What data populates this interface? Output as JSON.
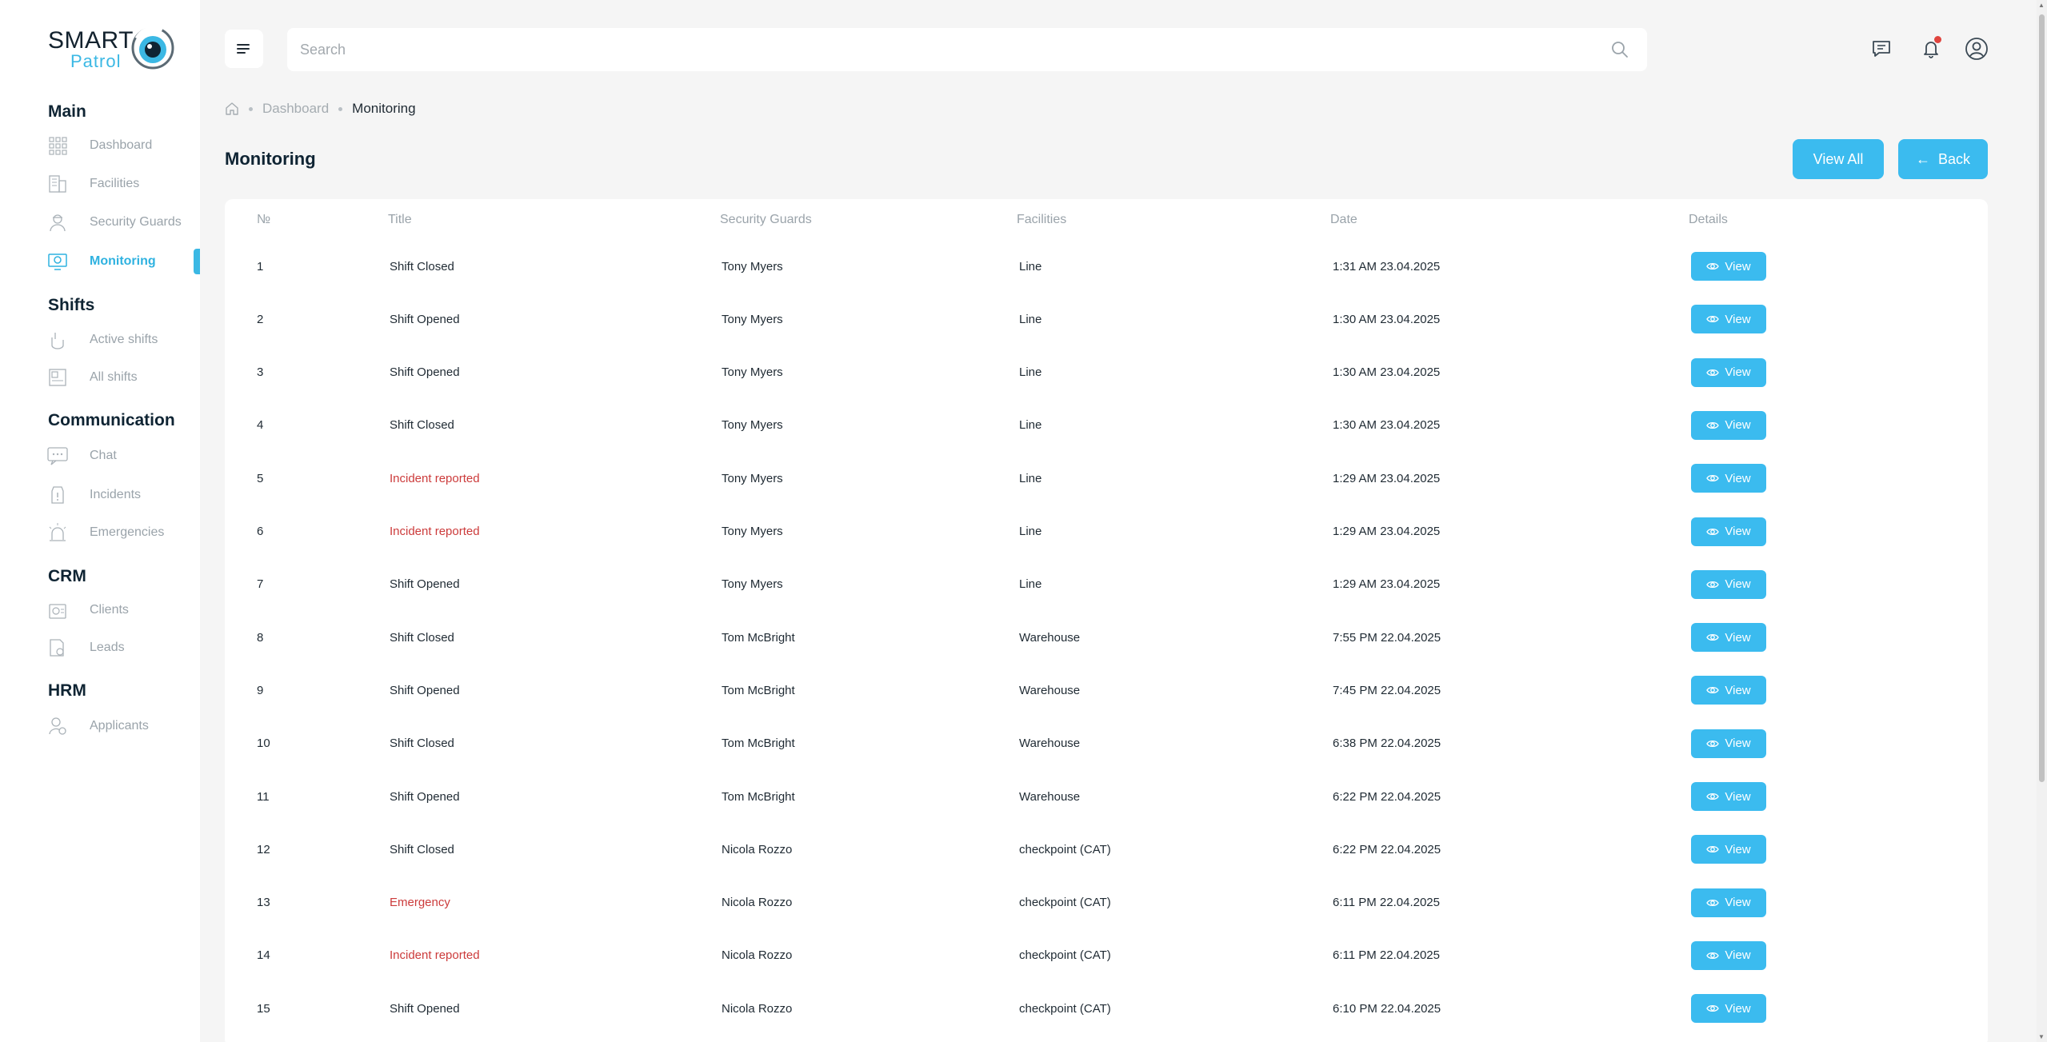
{
  "brand": {
    "name_top": "SMART",
    "name_bottom": "Patrol",
    "accent": "#3bb8e4"
  },
  "sidebar": {
    "sections": [
      {
        "title": "Main",
        "items": [
          {
            "label": "Dashboard",
            "icon": "dashboard-grid-icon"
          },
          {
            "label": "Facilities",
            "icon": "building-icon"
          },
          {
            "label": "Security Guards",
            "icon": "guard-icon"
          },
          {
            "label": "Monitoring",
            "icon": "monitor-icon",
            "active": true
          }
        ]
      },
      {
        "title": "Shifts",
        "items": [
          {
            "label": "Active shifts",
            "icon": "active-shifts-icon"
          },
          {
            "label": "All shifts",
            "icon": "all-shifts-icon"
          }
        ]
      },
      {
        "title": "Communication",
        "items": [
          {
            "label": "Chat",
            "icon": "chat-icon"
          },
          {
            "label": "Incidents",
            "icon": "incident-icon"
          },
          {
            "label": "Emergencies",
            "icon": "siren-icon"
          }
        ]
      },
      {
        "title": "CRM",
        "items": [
          {
            "label": "Clients",
            "icon": "clients-icon"
          },
          {
            "label": "Leads",
            "icon": "leads-icon"
          }
        ]
      },
      {
        "title": "HRM",
        "items": [
          {
            "label": "Applicants",
            "icon": "applicants-icon"
          }
        ]
      }
    ]
  },
  "topbar": {
    "search_placeholder": "Search",
    "icons": [
      "menu-icon",
      "search-icon",
      "messages-icon",
      "notification-bell-icon",
      "user-profile-icon"
    ]
  },
  "breadcrumb": {
    "home_icon": "home-icon",
    "items": [
      "Dashboard",
      "Monitoring"
    ]
  },
  "page": {
    "title": "Monitoring",
    "view_all_label": "View All",
    "back_label": "Back"
  },
  "table": {
    "headers": [
      "№",
      "Title",
      "Security Guards",
      "Facilities",
      "Date",
      "Details"
    ],
    "view_label": "View",
    "rows": [
      {
        "no": "1",
        "title": "Shift Closed",
        "guard": "Tony Myers",
        "facility": "Line",
        "date": "1:31 AM 23.04.2025",
        "alert": false
      },
      {
        "no": "2",
        "title": "Shift Opened",
        "guard": "Tony Myers",
        "facility": "Line",
        "date": "1:30 AM 23.04.2025",
        "alert": false
      },
      {
        "no": "3",
        "title": "Shift Opened",
        "guard": "Tony Myers",
        "facility": "Line",
        "date": "1:30 AM 23.04.2025",
        "alert": false
      },
      {
        "no": "4",
        "title": "Shift Closed",
        "guard": "Tony Myers",
        "facility": "Line",
        "date": "1:30 AM 23.04.2025",
        "alert": false
      },
      {
        "no": "5",
        "title": "Incident reported",
        "guard": "Tony Myers",
        "facility": "Line",
        "date": "1:29 AM 23.04.2025",
        "alert": true
      },
      {
        "no": "6",
        "title": "Incident reported",
        "guard": "Tony Myers",
        "facility": "Line",
        "date": "1:29 AM 23.04.2025",
        "alert": true
      },
      {
        "no": "7",
        "title": "Shift Opened",
        "guard": "Tony Myers",
        "facility": "Line",
        "date": "1:29 AM 23.04.2025",
        "alert": false
      },
      {
        "no": "8",
        "title": "Shift Closed",
        "guard": "Tom McBright",
        "facility": "Warehouse",
        "date": "7:55 PM 22.04.2025",
        "alert": false
      },
      {
        "no": "9",
        "title": "Shift Opened",
        "guard": "Tom McBright",
        "facility": "Warehouse",
        "date": "7:45 PM 22.04.2025",
        "alert": false
      },
      {
        "no": "10",
        "title": "Shift Closed",
        "guard": "Tom McBright",
        "facility": "Warehouse",
        "date": "6:38 PM 22.04.2025",
        "alert": false
      },
      {
        "no": "11",
        "title": "Shift Opened",
        "guard": "Tom McBright",
        "facility": "Warehouse",
        "date": "6:22 PM 22.04.2025",
        "alert": false
      },
      {
        "no": "12",
        "title": "Shift Closed",
        "guard": "Nicola Rozzo",
        "facility": "checkpoint (CAT)",
        "date": "6:22 PM 22.04.2025",
        "alert": false
      },
      {
        "no": "13",
        "title": "Emergency",
        "guard": "Nicola Rozzo",
        "facility": "checkpoint (CAT)",
        "date": "6:11 PM 22.04.2025",
        "alert": true
      },
      {
        "no": "14",
        "title": "Incident reported",
        "guard": "Nicola Rozzo",
        "facility": "checkpoint (CAT)",
        "date": "6:11 PM 22.04.2025",
        "alert": true
      },
      {
        "no": "15",
        "title": "Shift Opened",
        "guard": "Nicola Rozzo",
        "facility": "checkpoint (CAT)",
        "date": "6:10 PM 22.04.2025",
        "alert": false
      }
    ]
  },
  "colors": {
    "primary_button": "#3bbbef",
    "alert_text": "#cc3b3b",
    "notification_dot": "#e0443e"
  }
}
